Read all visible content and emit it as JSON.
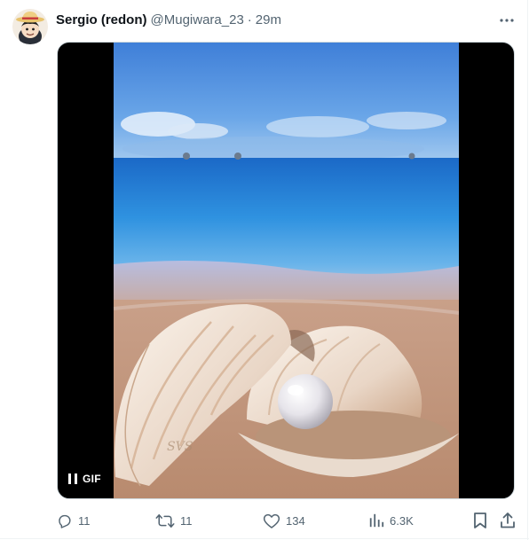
{
  "author": {
    "display_name": "Sergio (redon)",
    "handle": "@Mugiwara_23",
    "separator": "·",
    "timestamp": "29m",
    "avatar": "straw-hat-character-avatar"
  },
  "media": {
    "type_badge": "GIF",
    "control_icon": "pause-icon",
    "watermark": "SVS",
    "description_icon": "pearl-in-seashell-on-beach"
  },
  "actions": {
    "replies": "11",
    "retweets": "11",
    "likes": "134",
    "views": "6.3K"
  },
  "icons": {
    "reply": "speech-bubble-icon",
    "retweet": "retweet-icon",
    "like": "heart-icon",
    "views": "bar-chart-icon",
    "bookmark": "bookmark-icon",
    "share": "share-icon",
    "more": "more-dots-icon"
  },
  "colors": {
    "text": "#0f1419",
    "secondary": "#536471",
    "border": "#eff3f4"
  }
}
